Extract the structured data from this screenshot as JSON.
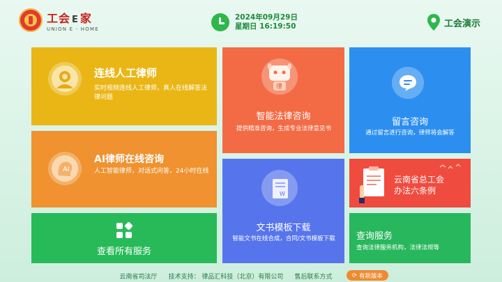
{
  "header": {
    "logo_title": "工会",
    "logo_e": "E",
    "logo_title_end": "家",
    "logo_sub": "UNION  E - HOME",
    "date": "2024年09月29日",
    "time": "星期日 16:19:50",
    "location": "工会演示"
  },
  "tiles": {
    "live_lawyer": {
      "title": "连线人工律师",
      "desc": "实时视频连线人工律师，真人在线解答法律问题",
      "icon": "lawyer-avatar-icon"
    },
    "ai_lawyer": {
      "title": "AI律师在线咨询",
      "desc": "人工智能律师，对话式问答，24小时在线",
      "icon": "ai-head-icon",
      "icon_text": "AI"
    },
    "all_services": {
      "title": "查看所有服务",
      "icon": "grid-apps-icon"
    },
    "smart_consult": {
      "title": "智能法律咨询",
      "desc": "提供精准咨询，生成专业法律意见书",
      "icon": "robot-icon",
      "icon_text": "律"
    },
    "doc_templates": {
      "title": "文书模板下载",
      "desc": "智能文书在线合成，合同/文书模板下载",
      "icon": "document-icon",
      "icon_text": "W"
    },
    "message_consult": {
      "title": "留言咨询",
      "desc": "通过留言进行咨询，律师将会解答",
      "icon": "chat-bubble-icon"
    },
    "yunnan_regulation": {
      "title": "云南省总工会办法六条例",
      "title_line1": "云南省总工会",
      "title_line2": "办法六条例",
      "icon": "clipboard-icon"
    },
    "query_service": {
      "title": "查询服务",
      "desc": "查询法律服务机构，法律法规等"
    }
  },
  "footer": {
    "dept": "云南省司法厅",
    "support": "技术支持：  律品汇科技（北京）有限公司",
    "after_sales": "售后联系方式",
    "update_button": "有新版本"
  },
  "colors": {
    "yellow": "#eab616",
    "orange": "#ef922f",
    "green": "#28ba59",
    "coral": "#f36b45",
    "indigo": "#5675ec",
    "blue": "#2c8ff0",
    "red": "#f04b3f"
  }
}
